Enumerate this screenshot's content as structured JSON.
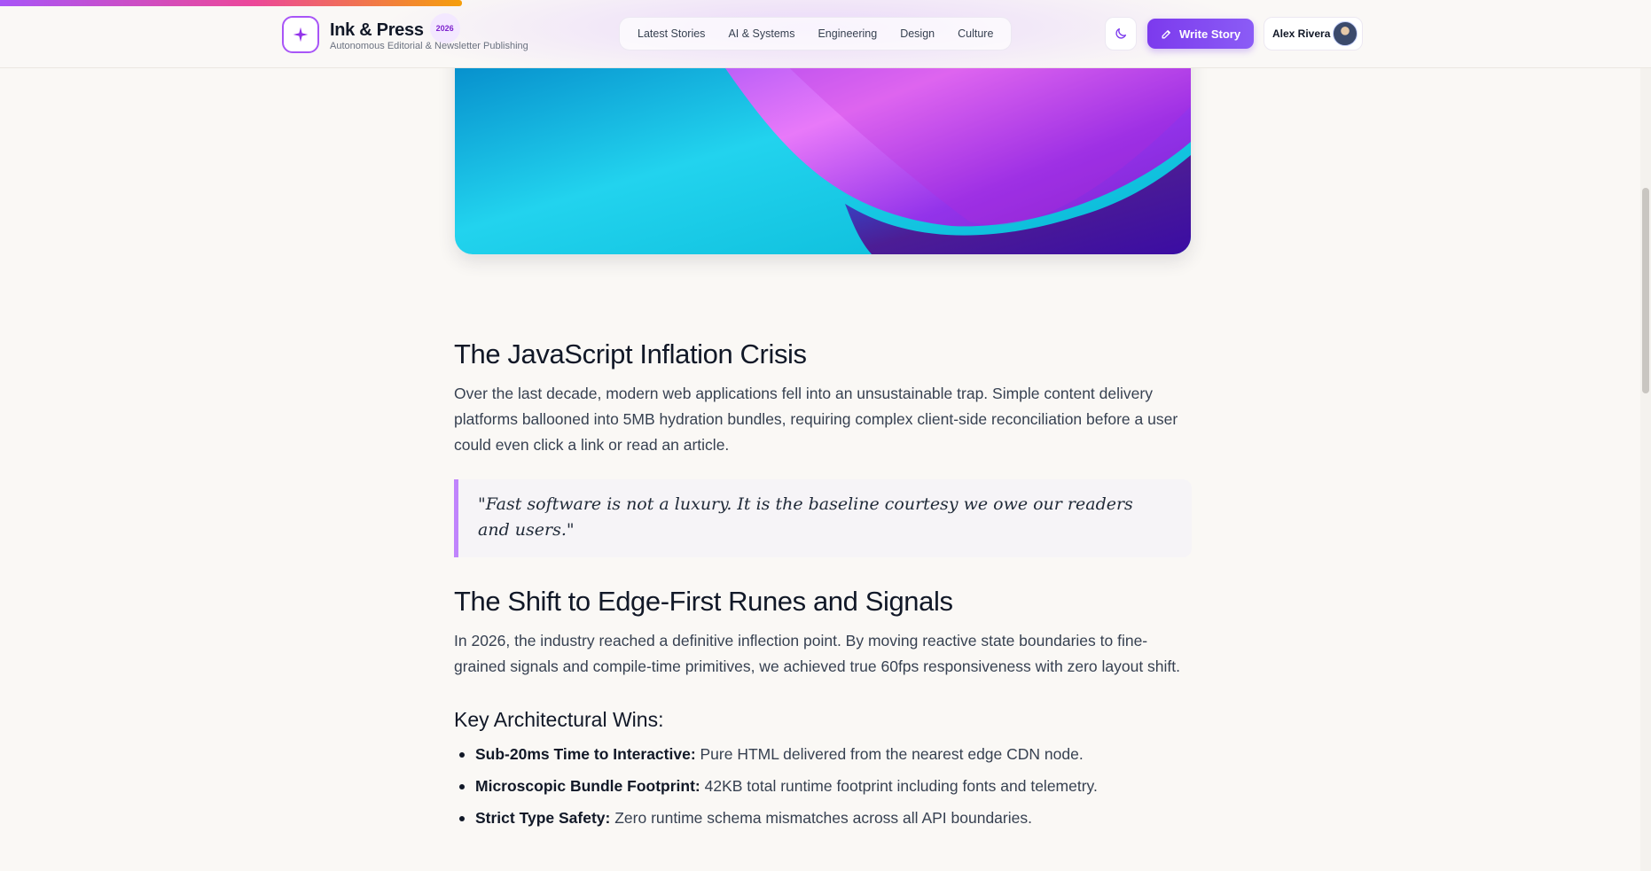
{
  "reading_progress": 0.28,
  "header": {
    "brand_title": "Ink & Press",
    "brand_badge": "2026",
    "brand_subtitle": "Autonomous Editorial & Newsletter Publishing",
    "logo_icon": "sparkle-icon",
    "nav": [
      {
        "label": "Latest Stories"
      },
      {
        "label": "AI & Systems"
      },
      {
        "label": "Engineering"
      },
      {
        "label": "Design"
      },
      {
        "label": "Culture"
      }
    ],
    "theme_icon": "moon-icon",
    "write_button": "Write Story",
    "user_name": "Alex Rivera"
  },
  "colors": {
    "accent": "#7c3aed",
    "quote_border": "#c084fc",
    "background": "#faf8f5"
  },
  "article": {
    "section1_title": "The JavaScript Inflation Crisis",
    "section1_body": "Over the last decade, modern web applications fell into an unsustainable trap. Simple content delivery platforms ballooned into 5MB hydration bundles, requiring complex client-side reconciliation before a user could even click a link or read an article.",
    "quote": "\"Fast software is not a luxury. It is the baseline courtesy we owe our readers and users.\"",
    "section2_title": "The Shift to Edge-First Runes and Signals",
    "section2_body": "In 2026, the industry reached a definitive inflection point. By moving reactive state boundaries to fine-grained signals and compile-time primitives, we achieved true 60fps responsiveness with zero layout shift.",
    "wins_title": "Key Architectural Wins:",
    "wins": [
      {
        "term": "Sub-20ms Time to Interactive:",
        "text": " Pure HTML delivered from the nearest edge CDN node."
      },
      {
        "term": "Microscopic Bundle Footprint:",
        "text": " 42KB total runtime footprint including fonts and telemetry."
      },
      {
        "term": "Strict Type Safety:",
        "text": " Zero runtime schema mismatches across all API boundaries."
      }
    ]
  }
}
